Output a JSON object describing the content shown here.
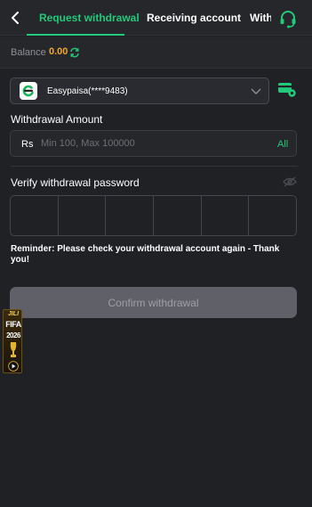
{
  "nav": {
    "back_icon": "chevron-left-icon",
    "tabs": [
      {
        "label": "Request withdrawal",
        "active": true
      },
      {
        "label": "Receiving account",
        "active": false
      },
      {
        "label": "With",
        "active": false
      }
    ],
    "support_icon": "headset-icon"
  },
  "balance": {
    "label": "Balance",
    "value": "0.00",
    "refresh_icon": "refresh-icon"
  },
  "account": {
    "logo_icon": "easypaisa-logo",
    "name": "Easypaisa(****9483)",
    "chevron_icon": "chevron-down-icon",
    "settings_icon": "card-settings-icon"
  },
  "amount": {
    "label": "Withdrawal Amount",
    "currency": "Rs",
    "placeholder": "Min 100, Max 100000",
    "all_label": "All"
  },
  "password": {
    "label": "Verify withdrawal password",
    "eye_icon": "eye-off-icon",
    "cells": 6
  },
  "reminder": "Reminder: Please check your withdrawal account again - Thank you!",
  "confirm_label": "Confirm withdrawal",
  "promo": {
    "brand": "JILI",
    "title": "FIFA",
    "year": "2026"
  },
  "colors": {
    "background": "#202125",
    "accent": "#22c97a",
    "balance": "#f4a62a",
    "button_disabled": "#5f6068"
  }
}
